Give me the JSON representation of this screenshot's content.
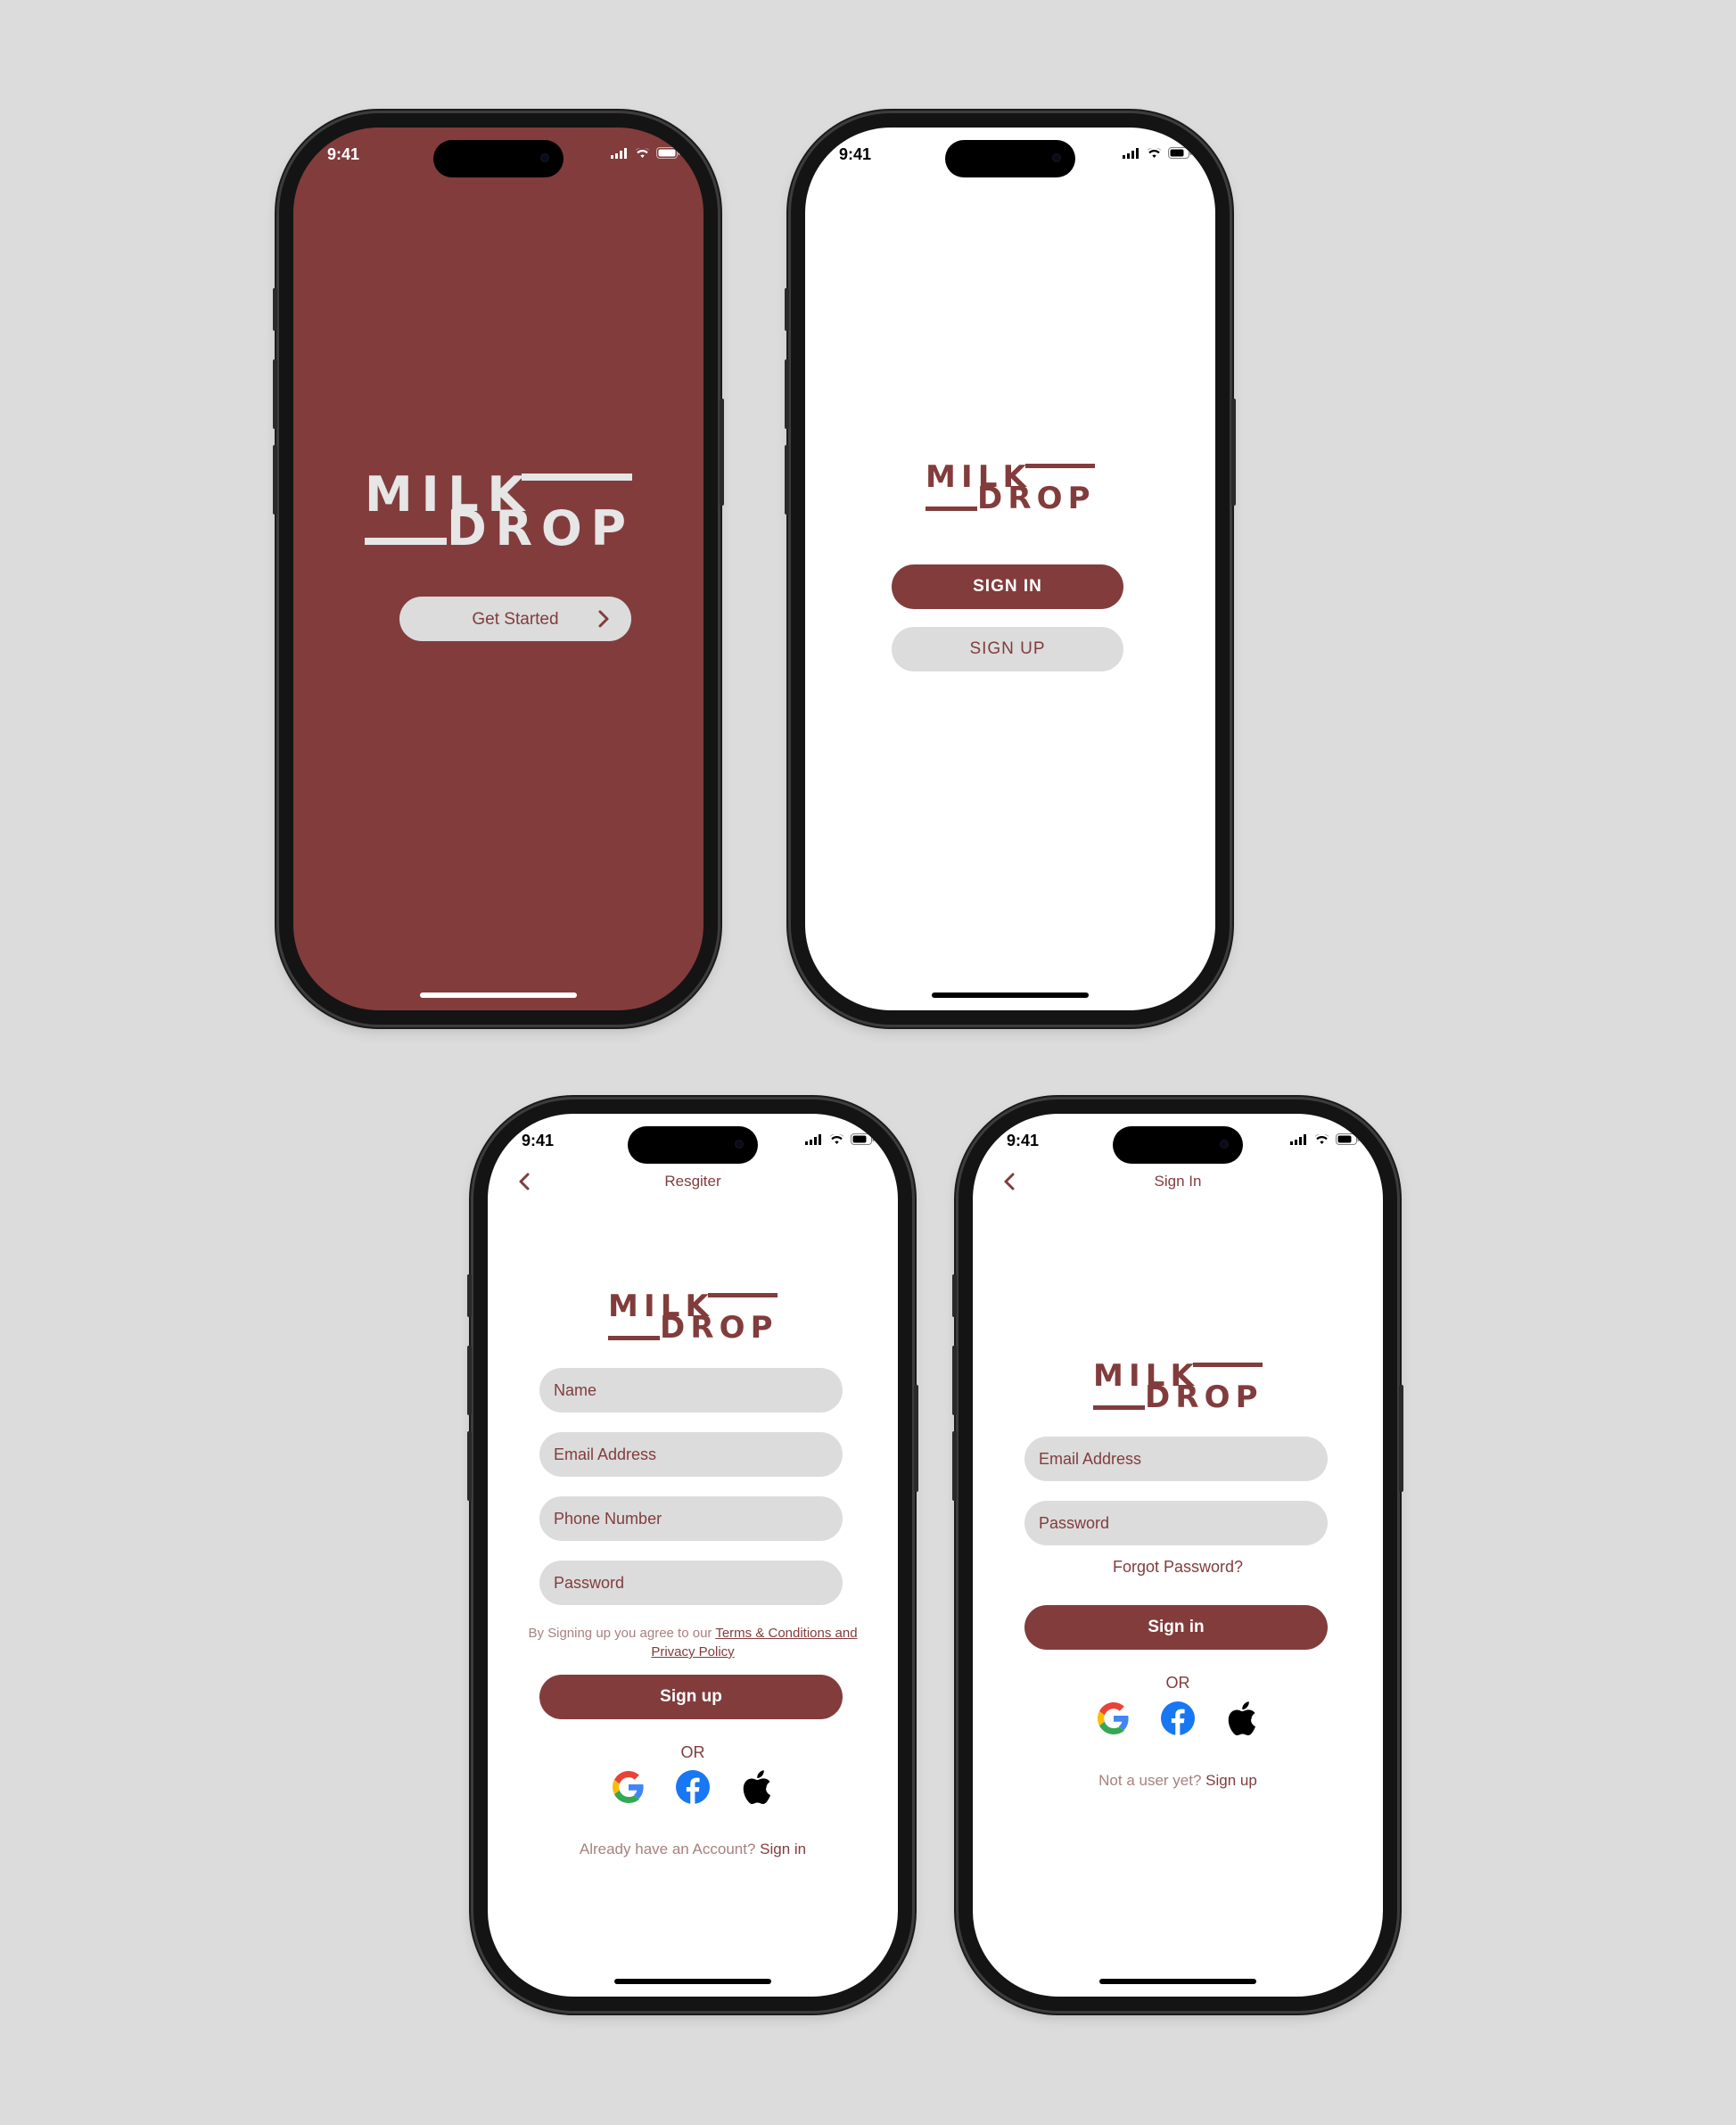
{
  "colors": {
    "brand": "#823c3c",
    "field_bg": "#dcdcdc",
    "page_bg": "#dcdcdc"
  },
  "status_bar": {
    "time": "9:41",
    "icons": [
      "signal-icon",
      "wifi-icon",
      "battery-icon"
    ]
  },
  "logo": {
    "line1": "MILK",
    "line2": "DROP"
  },
  "splash": {
    "get_started_label": "Get Started",
    "get_started_icon": "chevron-right-icon"
  },
  "welcome": {
    "sign_in_label": "SIGN IN",
    "sign_up_label": "SIGN UP"
  },
  "register": {
    "title": "Resgiter",
    "fields": {
      "name": "Name",
      "email": "Email Address",
      "phone": "Phone Number",
      "password": "Password"
    },
    "terms_prefix": "By Signing up you agree to our ",
    "terms_link": "Terms & Conditions and Privacy Policy",
    "submit_label": "Sign up",
    "or_label": "OR",
    "footer_text": "Already have an Account? ",
    "footer_link": "Sign in"
  },
  "signin": {
    "title": "Sign In",
    "fields": {
      "email": "Email Address",
      "password": "Password"
    },
    "forgot_label": "Forgot Password?",
    "submit_label": "Sign in",
    "or_label": "OR",
    "footer_text": "Not a user yet? ",
    "footer_link": "Sign up"
  },
  "social_icons": [
    "google-icon",
    "facebook-icon",
    "apple-icon"
  ]
}
